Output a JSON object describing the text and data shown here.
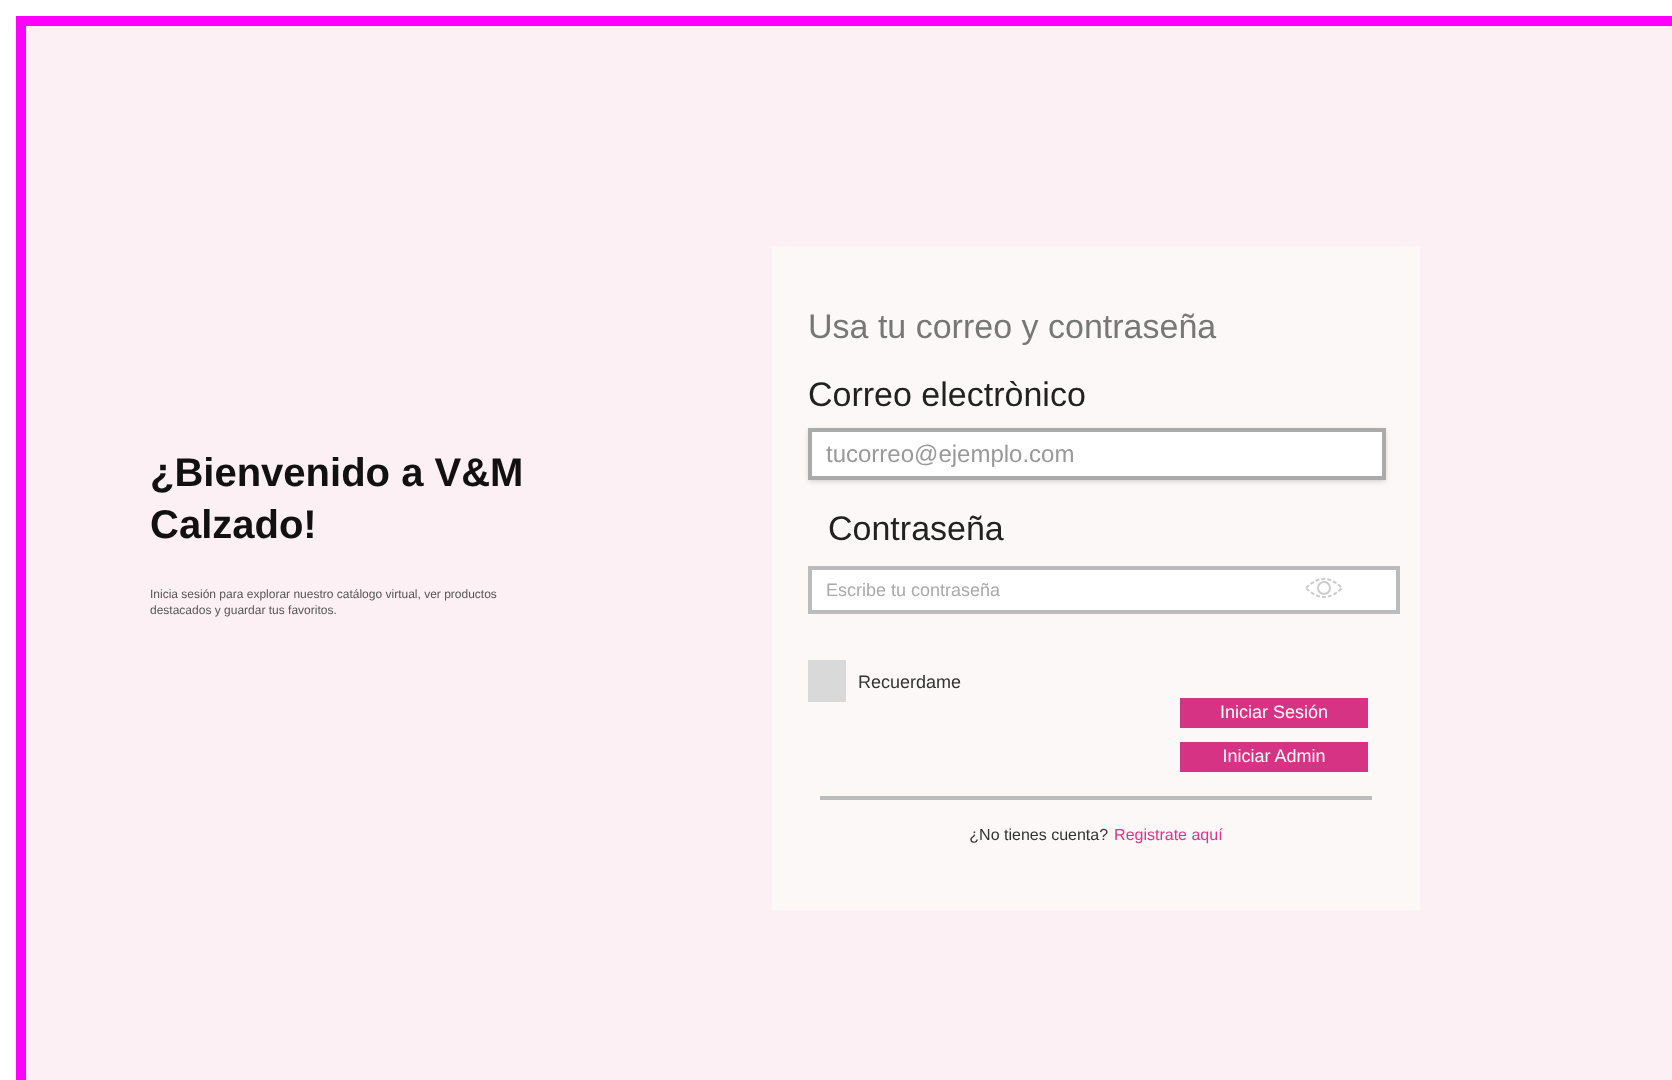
{
  "welcome": {
    "title": "¿Bienvenido a V&M Calzado!",
    "text": "Inicia sesión para explorar nuestro catálogo virtual, ver productos destacados y guardar tus favoritos."
  },
  "login": {
    "heading": "Usa tu correo y contraseña",
    "email": {
      "label": "Correo electrònico",
      "placeholder": "tucorreo@ejemplo.com"
    },
    "password": {
      "label": "Contraseña",
      "placeholder": "Escribe tu contraseña"
    },
    "remember": {
      "label": "Recuerdame",
      "checked": false
    },
    "buttons": [
      "Iniciar Sesión",
      "Iniciar Admin"
    ],
    "signup": {
      "text": "¿No tienes cuenta?",
      "link": "Registrate aquí"
    }
  }
}
